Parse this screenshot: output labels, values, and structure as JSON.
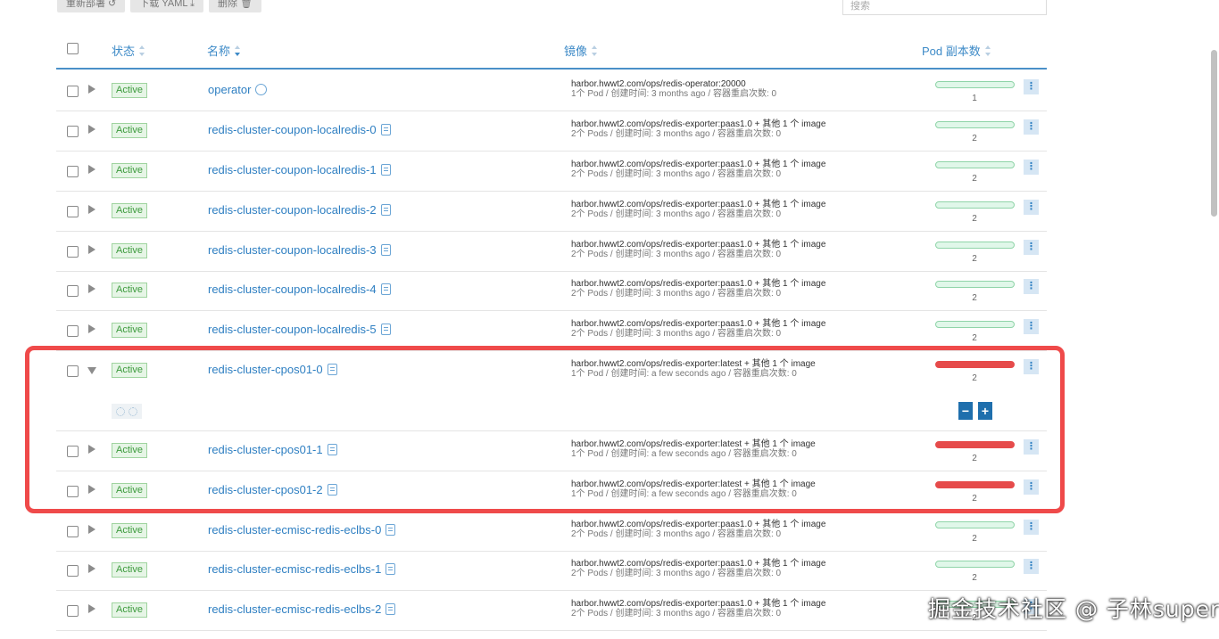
{
  "toolbar": {
    "redeploy": "重新部署 ↺",
    "download": "下载 YAML ⤓",
    "delete": "删除 🗑"
  },
  "search": {
    "placeholder": "搜索"
  },
  "columns": {
    "status": "状态",
    "name": "名称",
    "image": "镜像",
    "pods": "Pod 副本数"
  },
  "rows": [
    {
      "status": "Active",
      "name": "operator",
      "icon": "operator-icon",
      "image": "harbor.hwwt2.com/ops/redis-operator:20000",
      "sub": "1个 Pod / 创建时间: 3 months ago / 容器重启次数: 0",
      "count": "1",
      "bar": "green"
    },
    {
      "status": "Active",
      "name": "redis-cluster-coupon-localredis-0",
      "icon": "doc-icon",
      "image": "harbor.hwwt2.com/ops/redis-exporter:paas1.0 + 其他 1 个 image",
      "sub": "2个 Pods / 创建时间: 3 months ago / 容器重启次数: 0",
      "count": "2",
      "bar": "green"
    },
    {
      "status": "Active",
      "name": "redis-cluster-coupon-localredis-1",
      "icon": "doc-icon",
      "image": "harbor.hwwt2.com/ops/redis-exporter:paas1.0 + 其他 1 个 image",
      "sub": "2个 Pods / 创建时间: 3 months ago / 容器重启次数: 0",
      "count": "2",
      "bar": "green"
    },
    {
      "status": "Active",
      "name": "redis-cluster-coupon-localredis-2",
      "icon": "doc-icon",
      "image": "harbor.hwwt2.com/ops/redis-exporter:paas1.0 + 其他 1 个 image",
      "sub": "2个 Pods / 创建时间: 3 months ago / 容器重启次数: 0",
      "count": "2",
      "bar": "green"
    },
    {
      "status": "Active",
      "name": "redis-cluster-coupon-localredis-3",
      "icon": "doc-icon",
      "image": "harbor.hwwt2.com/ops/redis-exporter:paas1.0 + 其他 1 个 image",
      "sub": "2个 Pods / 创建时间: 3 months ago / 容器重启次数: 0",
      "count": "2",
      "bar": "green"
    },
    {
      "status": "Active",
      "name": "redis-cluster-coupon-localredis-4",
      "icon": "doc-icon",
      "image": "harbor.hwwt2.com/ops/redis-exporter:paas1.0 + 其他 1 个 image",
      "sub": "2个 Pods / 创建时间: 3 months ago / 容器重启次数: 0",
      "count": "2",
      "bar": "green"
    },
    {
      "status": "Active",
      "name": "redis-cluster-coupon-localredis-5",
      "icon": "doc-icon",
      "image": "harbor.hwwt2.com/ops/redis-exporter:paas1.0 + 其他 1 个 image",
      "sub": "2个 Pods / 创建时间: 3 months ago / 容器重启次数: 0",
      "count": "2",
      "bar": "green"
    },
    {
      "status": "Active",
      "name": "redis-cluster-cpos01-0",
      "icon": "doc-icon",
      "image": "harbor.hwwt2.com/ops/redis-exporter:latest + 其他 1 个 image",
      "sub": "1个 Pod / 创建时间: a few seconds ago / 容器重启次数: 0",
      "count": "2",
      "bar": "red",
      "expanded": true
    },
    {
      "status": "Active",
      "name": "redis-cluster-cpos01-1",
      "icon": "doc-icon",
      "image": "harbor.hwwt2.com/ops/redis-exporter:latest + 其他 1 个 image",
      "sub": "1个 Pod / 创建时间: a few seconds ago / 容器重启次数: 0",
      "count": "2",
      "bar": "red"
    },
    {
      "status": "Active",
      "name": "redis-cluster-cpos01-2",
      "icon": "doc-icon",
      "image": "harbor.hwwt2.com/ops/redis-exporter:latest + 其他 1 个 image",
      "sub": "1个 Pod / 创建时间: a few seconds ago / 容器重启次数: 0",
      "count": "2",
      "bar": "red"
    },
    {
      "status": "Active",
      "name": "redis-cluster-ecmisc-redis-eclbs-0",
      "icon": "doc-icon",
      "image": "harbor.hwwt2.com/ops/redis-exporter:paas1.0 + 其他 1 个 image",
      "sub": "2个 Pods / 创建时间: 3 months ago / 容器重启次数: 0",
      "count": "2",
      "bar": "green"
    },
    {
      "status": "Active",
      "name": "redis-cluster-ecmisc-redis-eclbs-1",
      "icon": "doc-icon",
      "image": "harbor.hwwt2.com/ops/redis-exporter:paas1.0 + 其他 1 个 image",
      "sub": "2个 Pods / 创建时间: 3 months ago / 容器重启次数: 0",
      "count": "2",
      "bar": "green"
    },
    {
      "status": "Active",
      "name": "redis-cluster-ecmisc-redis-eclbs-2",
      "icon": "doc-icon",
      "image": "harbor.hwwt2.com/ops/redis-exporter:paas1.0 + 其他 1 个 image",
      "sub": "2个 Pods / 创建时间: 3 months ago / 容器重启次数: 0",
      "count": "2",
      "bar": "green"
    }
  ],
  "stepper": {
    "minus": "−",
    "plus": "+"
  },
  "kebab": "⋮",
  "colors": {
    "accent": "#2e7fc2",
    "active_badge": "#3c9a3c",
    "highlight": "#ef4a4a",
    "bar_ok": "#e0f7e9",
    "bar_error": "#e64b4b"
  },
  "watermark": "掘金技术社区 @ 子林super"
}
